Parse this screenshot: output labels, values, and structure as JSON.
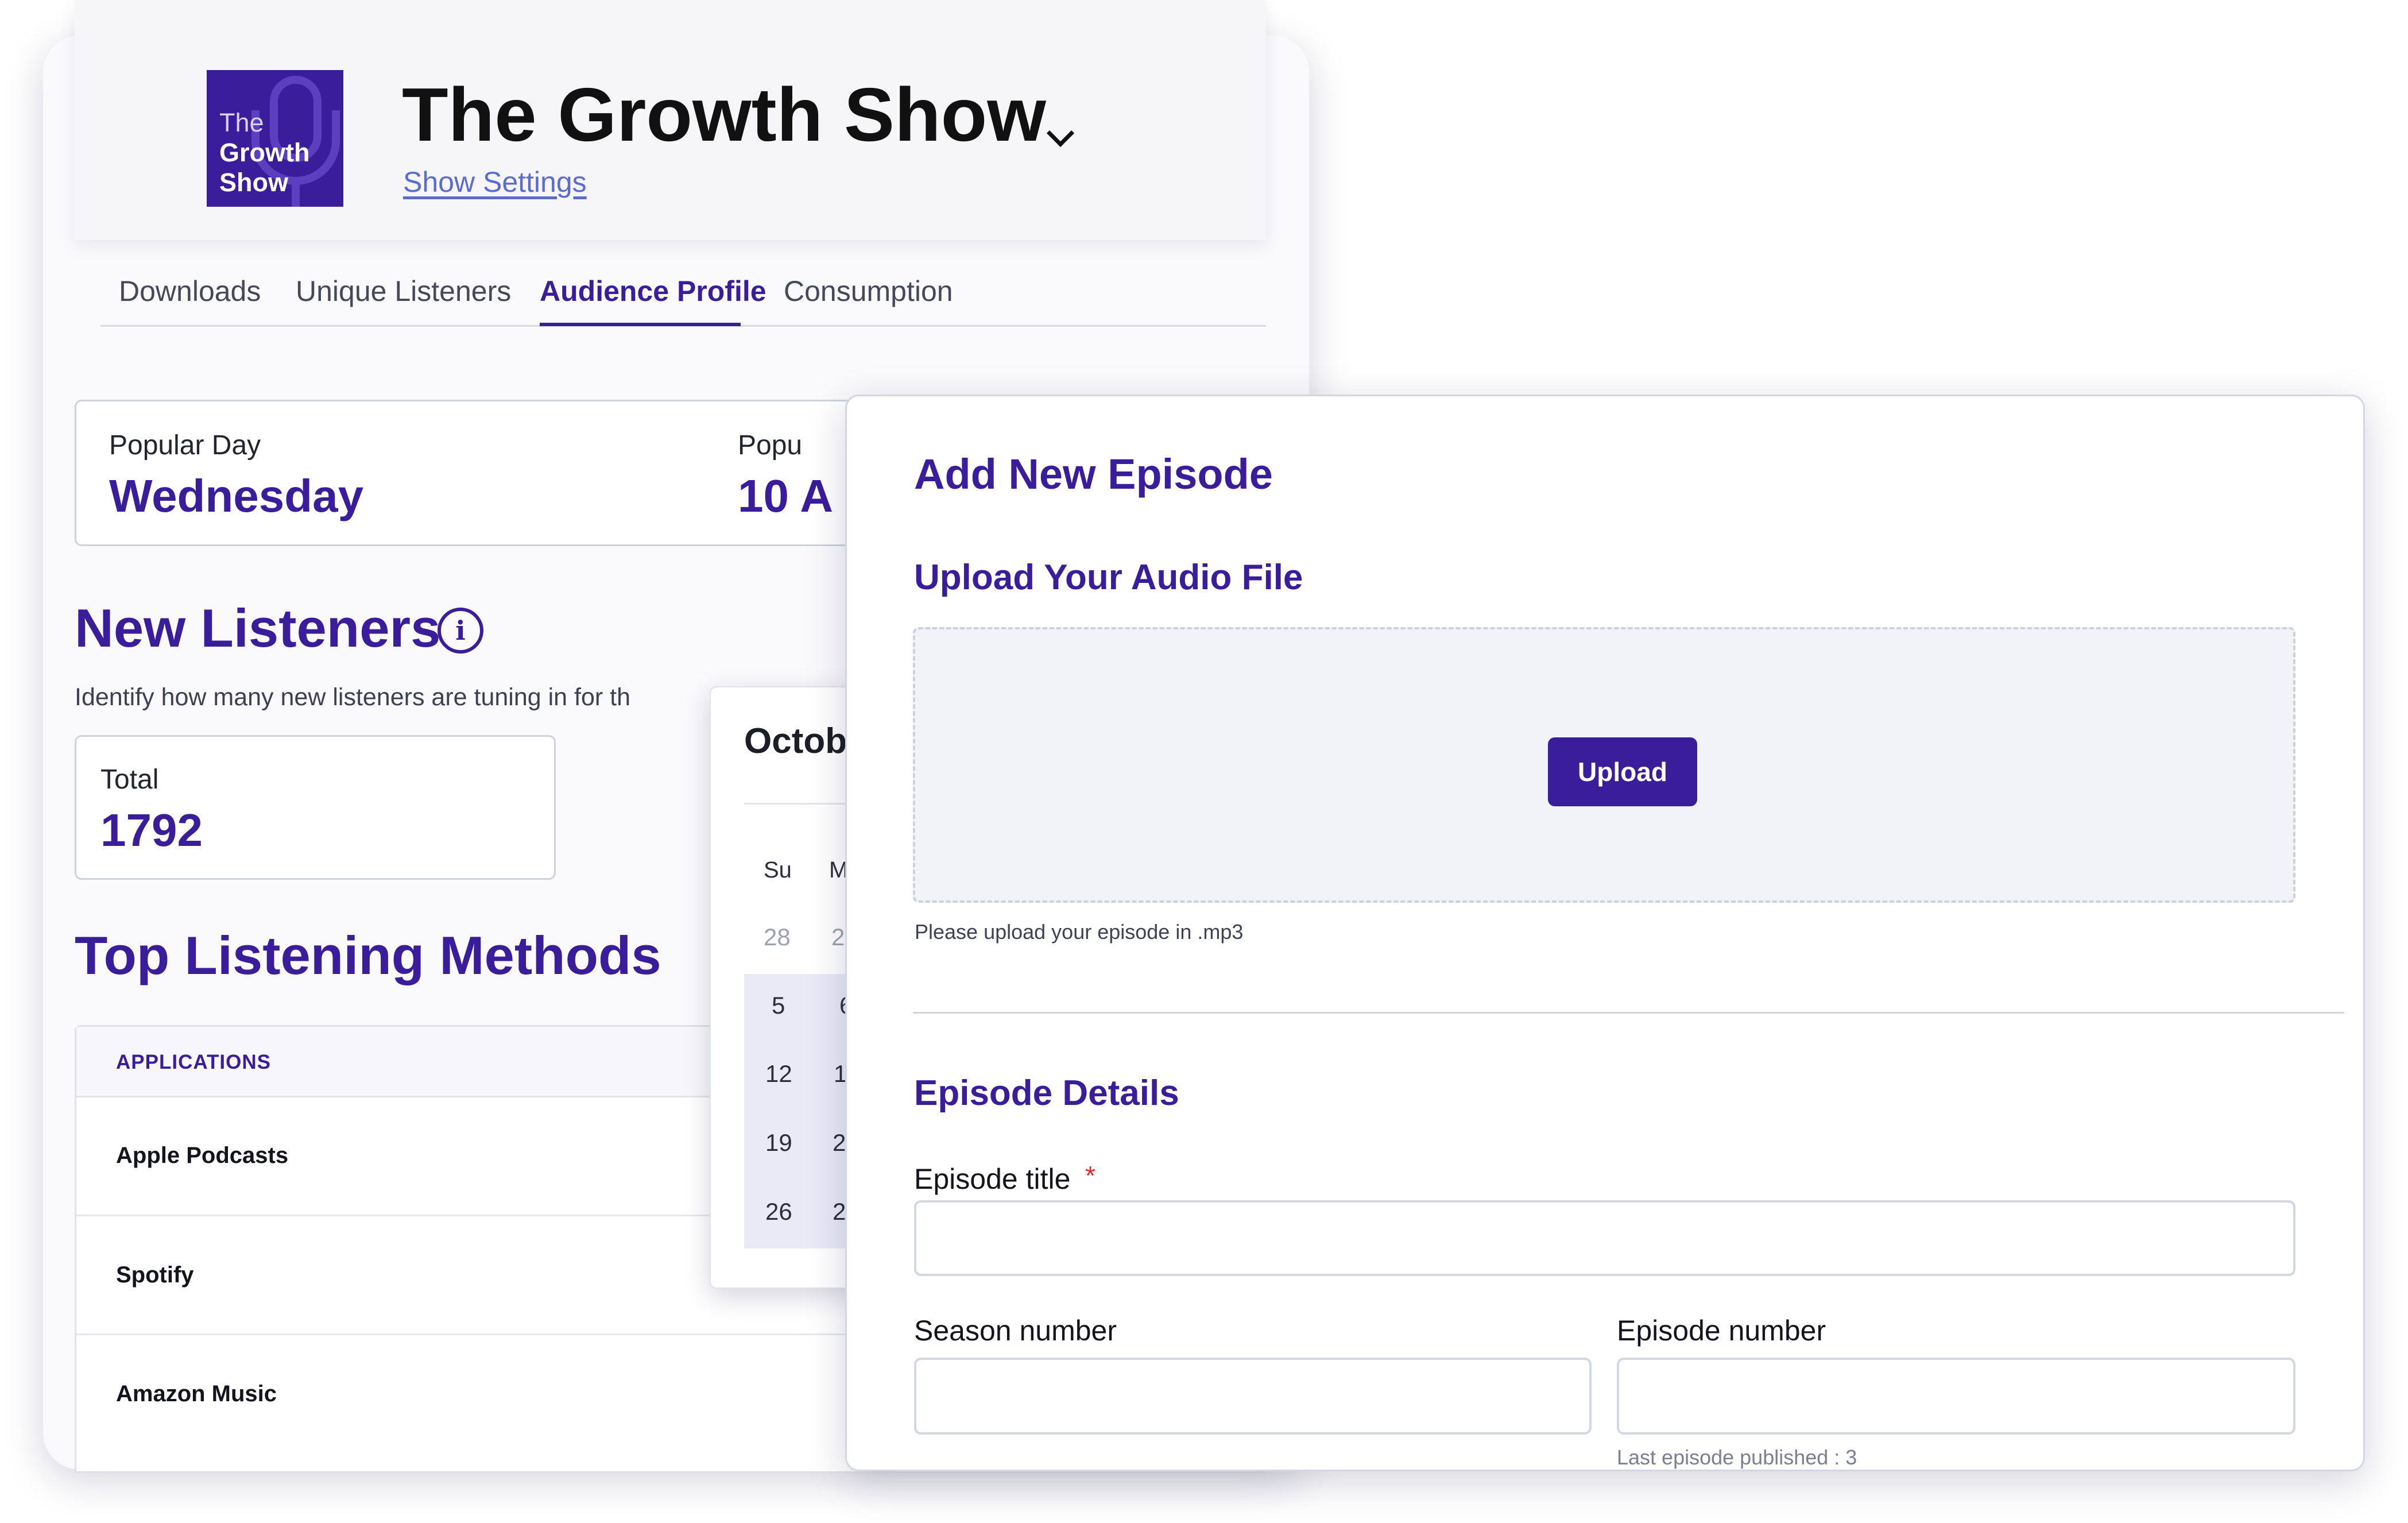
{
  "show": {
    "logo_lines": [
      "The",
      "Growth",
      "Show"
    ],
    "title": "The Growth Show",
    "settings_link": "Show Settings"
  },
  "tabs": [
    {
      "label": "Downloads"
    },
    {
      "label": "Unique Listeners"
    },
    {
      "label": "Audience Profile",
      "active": true
    },
    {
      "label": "Consumption"
    }
  ],
  "popular": {
    "day_label": "Popular Day",
    "day_value": "Wednesday",
    "time_label": "Popu",
    "time_value": "10 A"
  },
  "new_listeners": {
    "heading": "New Listeners",
    "info_icon": "i",
    "description": "Identify how many new listeners are tuning in for th",
    "total_label": "Total",
    "total_value": "1792"
  },
  "top_methods": {
    "heading": "Top Listening Methods",
    "column_header": "APPLICATIONS",
    "rows": [
      "Apple Podcasts",
      "Spotify",
      "Amazon Music"
    ]
  },
  "calendar": {
    "month": "Octob",
    "weekdays": [
      "Su",
      "M"
    ],
    "days": [
      [
        "28",
        "2"
      ],
      [
        "5",
        "6"
      ],
      [
        "12",
        "1"
      ],
      [
        "19",
        "2"
      ],
      [
        "26",
        "2"
      ]
    ]
  },
  "episode_form": {
    "heading": "Add New Episode",
    "upload_heading": "Upload Your Audio File",
    "upload_button": "Upload",
    "upload_hint": "Please upload your episode in .mp3",
    "details_heading": "Episode Details",
    "title_label": "Episode title",
    "required_marker": "*",
    "title_value": "",
    "season_label": "Season number",
    "season_value": "",
    "episode_label": "Episode number",
    "episode_value": "",
    "last_episode_hint": "Last episode published : 3"
  },
  "colors": {
    "brand": "#3a1d9a",
    "link": "#5b6bd0",
    "required": "#e02a2a"
  }
}
